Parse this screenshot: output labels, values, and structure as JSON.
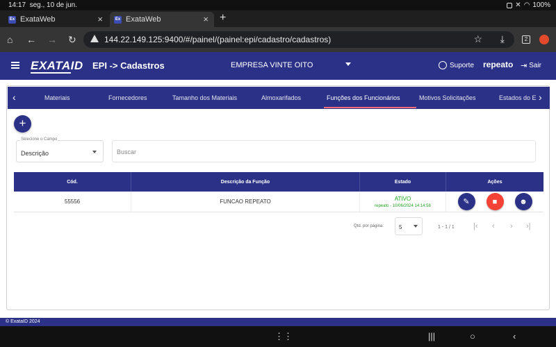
{
  "status_bar": {
    "time": "14:17",
    "date": "seg., 10 de jun.",
    "battery": "100%"
  },
  "browser": {
    "tabs": [
      {
        "title": "ExataWeb",
        "favicon": "Ex"
      },
      {
        "title": "ExataWeb",
        "favicon": "Ex"
      }
    ],
    "url": "144.22.149.125:9400/#/painel/(painel:epi/cadastro/cadastros)",
    "tab_count": "2"
  },
  "header": {
    "logo": "EXATA",
    "logo_id": "ID",
    "title": "EPI -> Cadastros",
    "company": "EMPRESA VINTE OITO",
    "support": "Suporte",
    "user": "repeato",
    "logout": "Sair"
  },
  "subtabs": [
    "Materiais",
    "Fornecedores",
    "Tamanho dos Materiais",
    "Almoxarifados",
    "Funções dos Funcionários",
    "Motivos Solicitações",
    "Estados do E"
  ],
  "active_subtab": "Funções dos Funcionários",
  "filters": {
    "select_label": "Selecione o Campo",
    "select_value": "Descrição",
    "search_placeholder": "Buscar"
  },
  "table": {
    "columns": [
      "Cód.",
      "Descrição da Função",
      "Estado",
      "Ações"
    ],
    "rows": [
      {
        "code": "55556",
        "description": "FUNCAO REPEATO",
        "status": "ATIVO",
        "status_detail": "repeato - 10/06/2024 14:14:58"
      }
    ]
  },
  "paginator": {
    "label": "Qtd. por página:",
    "page_size": "5",
    "range": "1 - 1 / 1"
  },
  "footer": "© ExataID 2024",
  "colors": {
    "primary": "#2a3186",
    "danger": "#f44336",
    "success": "#1fa31f",
    "active_tab_indicator": "#ff6d7a"
  }
}
